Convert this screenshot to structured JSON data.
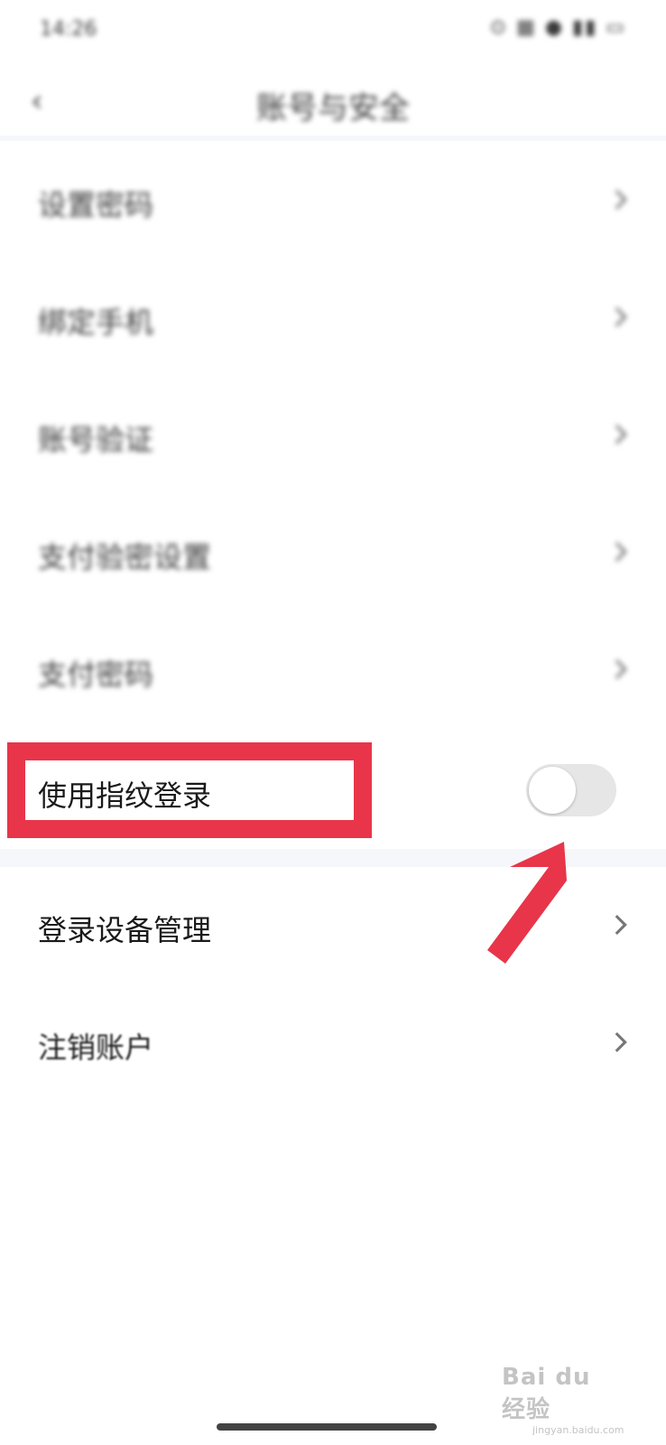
{
  "statusbar": {
    "time": "14:26",
    "icons": "⊙ ▦ ● ▮▮ ▭"
  },
  "navbar": {
    "title": "账号与安全",
    "back": "‹"
  },
  "items": [
    {
      "label": "设置密码",
      "chevron": true
    },
    {
      "label": "绑定手机",
      "chevron": true
    },
    {
      "label": "账号验证",
      "chevron": true
    },
    {
      "label": "支付验密设置",
      "chevron": true
    },
    {
      "label": "支付密码",
      "chevron": true
    }
  ],
  "fingerprint": {
    "label": "使用指纹登录",
    "enabled": false
  },
  "device_manage": {
    "label": "登录设备管理"
  },
  "deactivate": {
    "label": "注销账户"
  },
  "watermark": {
    "main": "Bai du 经验",
    "sub": "jingyan.baidu.com"
  },
  "colors": {
    "highlight": "#e8354a",
    "toggle_off": "#e6e6e6"
  }
}
